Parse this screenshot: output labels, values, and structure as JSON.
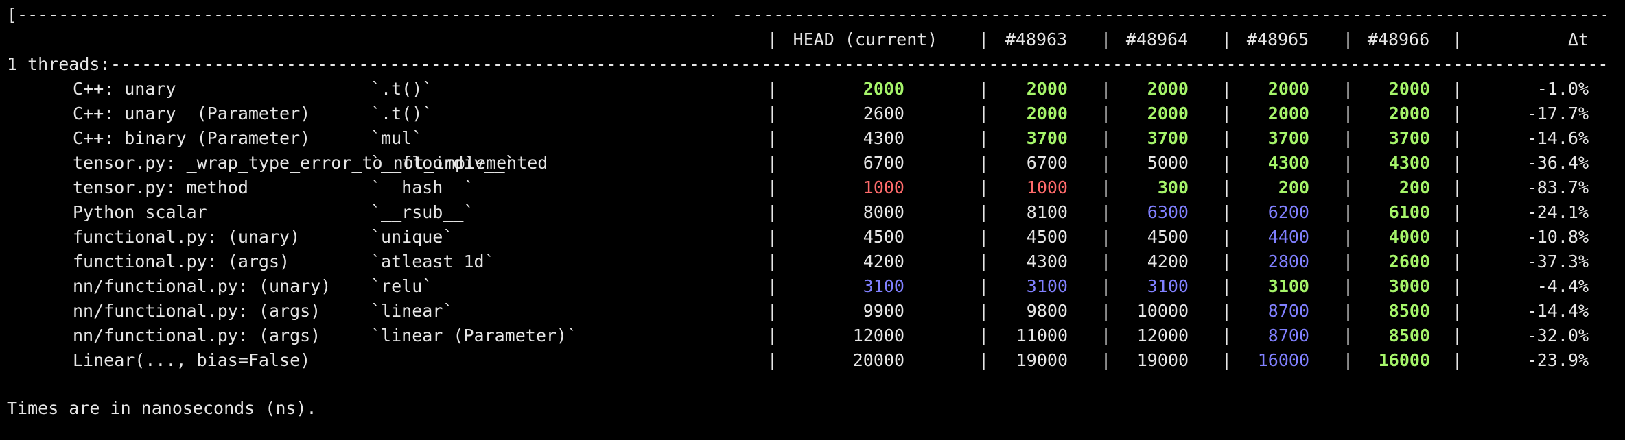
{
  "colors": {
    "background": "#000000",
    "text": "#e6e6e6",
    "green": "#a6f56a",
    "red": "#ff6b6b",
    "blue": "#8080ff"
  },
  "top_rule": {
    "left": "[--------------------------------------------------------------------------",
    "right": "------------------------------------------------------------------------------------------------------------------]"
  },
  "header": {
    "sep": "|",
    "columns": [
      "HEAD (current)",
      "#48963",
      "#48964",
      "#48965",
      "#48966"
    ],
    "delta": "Δt"
  },
  "threads_line": {
    "label": "1 threads:",
    "rule": "--------------------------------------------------------------------------------------------------------------------------------------------------------------------------------------------------------------"
  },
  "rows": [
    {
      "name": "C++: unary",
      "op": "`.t()`",
      "values": [
        "2000",
        "2000",
        "2000",
        "2000",
        "2000"
      ],
      "colors": [
        "green",
        "green",
        "green",
        "green",
        "green"
      ],
      "delta": "-1.0%"
    },
    {
      "name": "C++: unary  (Parameter)",
      "op": "`.t()`",
      "values": [
        "2600",
        "2000",
        "2000",
        "2000",
        "2000"
      ],
      "colors": [
        "white",
        "green",
        "green",
        "green",
        "green"
      ],
      "delta": "-17.7%"
    },
    {
      "name": "C++: binary (Parameter)",
      "op": "`mul`",
      "values": [
        "4300",
        "3700",
        "3700",
        "3700",
        "3700"
      ],
      "colors": [
        "white",
        "green",
        "green",
        "green",
        "green"
      ],
      "delta": "-14.6%"
    },
    {
      "name": "tensor.py: _wrap_type_error_to_not_implemented",
      "op": "`__floordiv__`",
      "values": [
        "6700",
        "6700",
        "5000",
        "4300",
        "4300"
      ],
      "colors": [
        "white",
        "white",
        "white",
        "green",
        "green"
      ],
      "delta": "-36.4%"
    },
    {
      "name": "tensor.py: method",
      "op": "`__hash__`",
      "values": [
        "1000",
        "1000",
        "300",
        "200",
        "200"
      ],
      "colors": [
        "red",
        "red",
        "green",
        "green",
        "green"
      ],
      "delta": "-83.7%"
    },
    {
      "name": "Python scalar",
      "op": "`__rsub__`",
      "values": [
        "8000",
        "8100",
        "6300",
        "6200",
        "6100"
      ],
      "colors": [
        "white",
        "white",
        "blue",
        "blue",
        "green"
      ],
      "delta": "-24.1%"
    },
    {
      "name": "functional.py: (unary)",
      "op": "`unique`",
      "values": [
        "4500",
        "4500",
        "4500",
        "4400",
        "4000"
      ],
      "colors": [
        "white",
        "white",
        "white",
        "blue",
        "green"
      ],
      "delta": "-10.8%"
    },
    {
      "name": "functional.py: (args)",
      "op": "`atleast_1d`",
      "values": [
        "4200",
        "4300",
        "4200",
        "2800",
        "2600"
      ],
      "colors": [
        "white",
        "white",
        "white",
        "blue",
        "green"
      ],
      "delta": "-37.3%"
    },
    {
      "name": "nn/functional.py: (unary)",
      "op": "`relu`",
      "values": [
        "3100",
        "3100",
        "3100",
        "3100",
        "3000"
      ],
      "colors": [
        "blue",
        "blue",
        "blue",
        "green",
        "green"
      ],
      "delta": "-4.4%"
    },
    {
      "name": "nn/functional.py: (args)",
      "op": "`linear`",
      "values": [
        "9900",
        "9800",
        "10000",
        "8700",
        "8500"
      ],
      "colors": [
        "white",
        "white",
        "white",
        "blue",
        "green"
      ],
      "delta": "-14.4%"
    },
    {
      "name": "nn/functional.py: (args)",
      "op": "`linear (Parameter)`",
      "values": [
        "12000",
        "11000",
        "12000",
        "8700",
        "8500"
      ],
      "colors": [
        "white",
        "white",
        "white",
        "blue",
        "green"
      ],
      "delta": "-32.0%"
    },
    {
      "name": "Linear(..., bias=False)",
      "op": "",
      "values": [
        "20000",
        "19000",
        "19000",
        "16000",
        "16000"
      ],
      "colors": [
        "white",
        "white",
        "white",
        "blue",
        "green"
      ],
      "delta": "-23.9%"
    }
  ],
  "footer": "Times are in nanoseconds (ns)."
}
